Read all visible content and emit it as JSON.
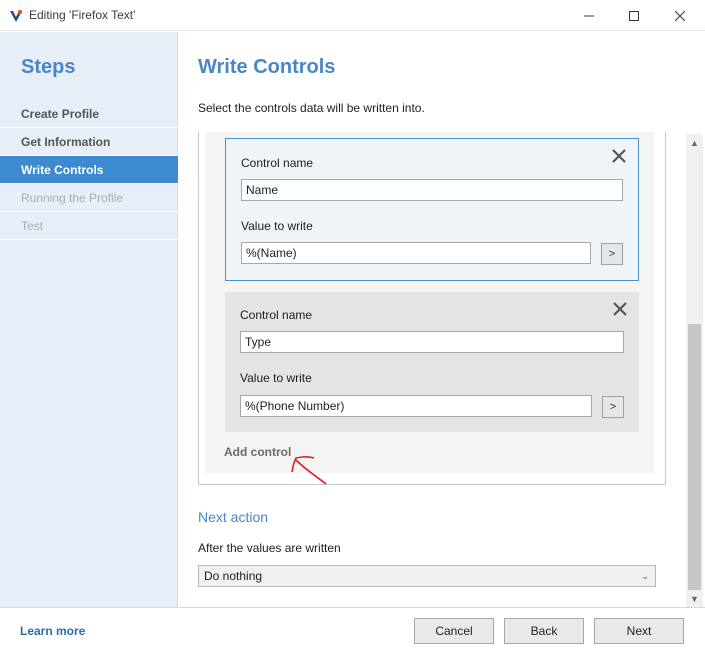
{
  "window": {
    "title": "Editing 'Firefox Text'",
    "minimize_icon": "minimize-icon",
    "maximize_icon": "maximize-icon",
    "close_icon": "close-icon"
  },
  "sidebar": {
    "title": "Steps",
    "items": [
      {
        "label": "Create Profile",
        "state": "done"
      },
      {
        "label": "Get Information",
        "state": "done"
      },
      {
        "label": "Write Controls",
        "state": "active"
      },
      {
        "label": "Running the Profile",
        "state": "disabled"
      },
      {
        "label": "Test",
        "state": "disabled"
      }
    ]
  },
  "main": {
    "title": "Write Controls",
    "description": "Select the controls data will be written into.",
    "controls": [
      {
        "name_label": "Control name",
        "name_value": "Name",
        "value_label": "Value to write",
        "value_value": "%(Name)",
        "pick_label": ">"
      },
      {
        "name_label": "Control name",
        "name_value": "Type",
        "value_label": "Value to write",
        "value_value": "%(Phone Number)",
        "pick_label": ">"
      }
    ],
    "add_control_label": "Add control",
    "next_action_heading": "Next action",
    "after_label": "After the values are written",
    "after_select_value": "Do nothing"
  },
  "footer": {
    "learn_more": "Learn more",
    "cancel": "Cancel",
    "back": "Back",
    "next": "Next"
  },
  "colors": {
    "accent": "#4a86c5",
    "active_step": "#3e8ad0",
    "annotation": "#e02020"
  }
}
